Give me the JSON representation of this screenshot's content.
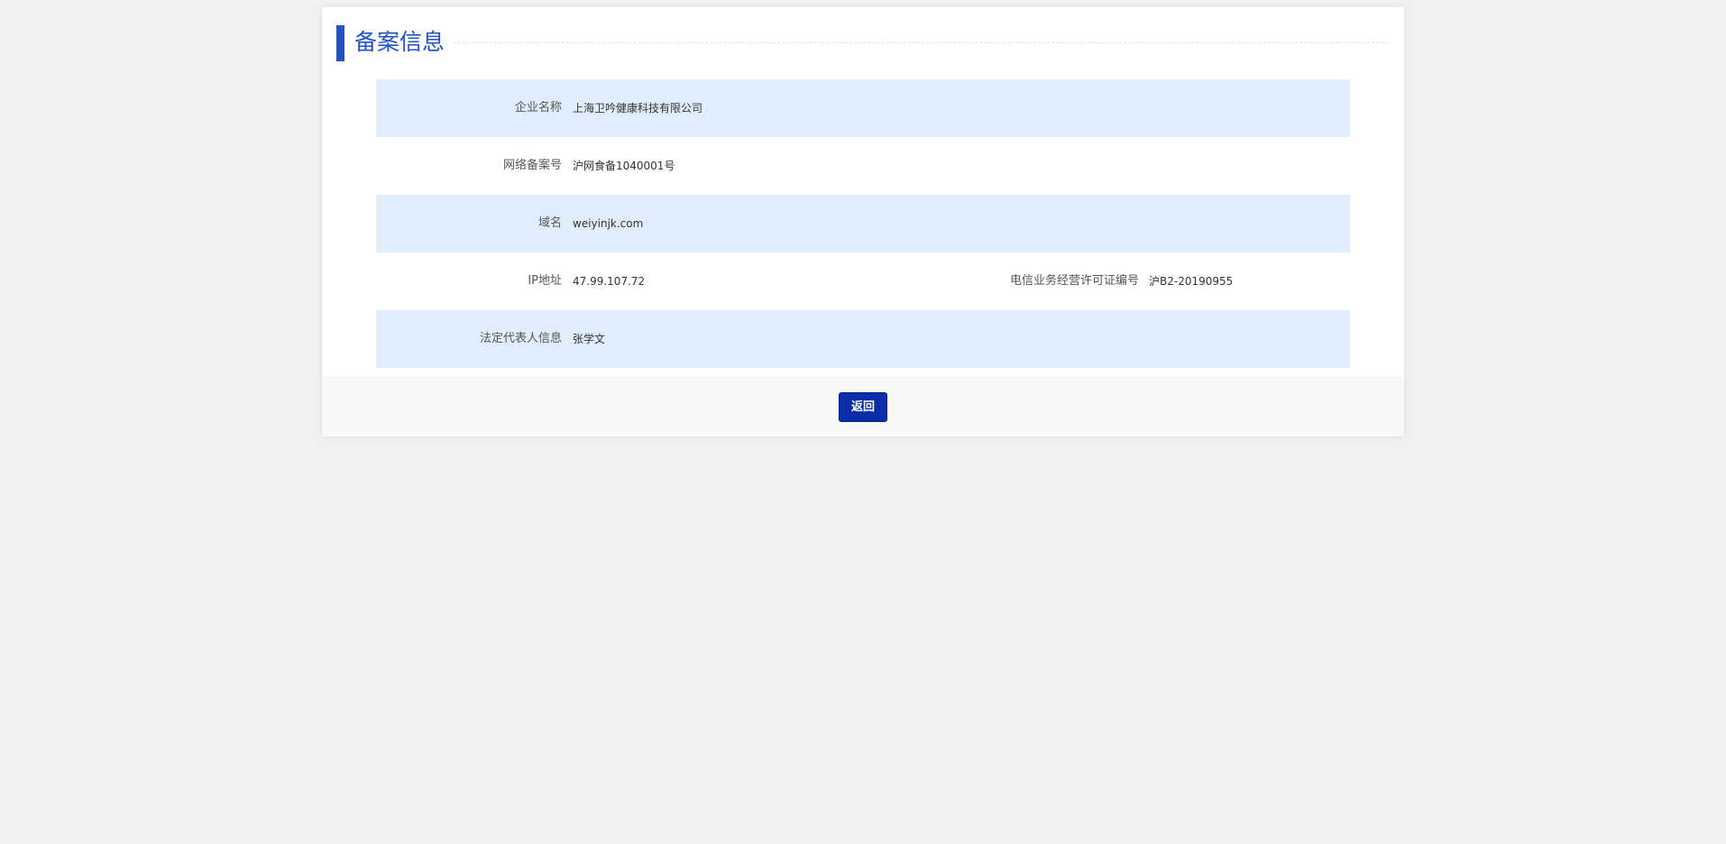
{
  "header": {
    "title": "备案信息"
  },
  "rows": [
    {
      "label": "企业名称",
      "value": "上海卫吟健康科技有限公司"
    },
    {
      "label": "网络备案号",
      "value": "沪网食备1040001号"
    },
    {
      "label": "域名",
      "value": "weiyinjk.com"
    },
    {
      "label": "IP地址",
      "value": "47.99.107.72",
      "second_label": "电信业务经营许可证编号",
      "second_value": "沪B2-20190955"
    },
    {
      "label": "法定代表人信息",
      "value": "张学文"
    }
  ],
  "footer": {
    "back_label": "返回"
  },
  "colors": {
    "accent": "#2250c9",
    "row_shade": "#e0edfd",
    "button": "#0b2ea8",
    "page_bg": "#f1f1f1"
  }
}
